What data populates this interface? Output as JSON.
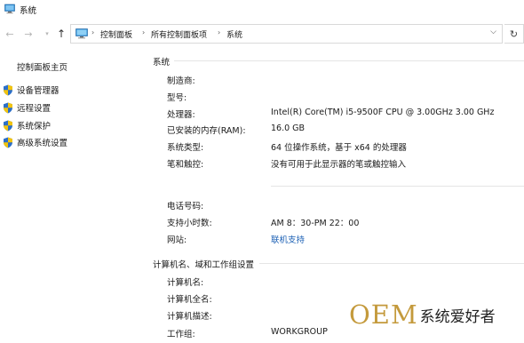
{
  "window": {
    "title": "系统"
  },
  "address": {
    "breadcrumbs": [
      "控制面板",
      "所有控制面板项",
      "系统"
    ]
  },
  "sidebar": {
    "home": "控制面板主页",
    "items": [
      {
        "label": "设备管理器",
        "icon": "shield-icon"
      },
      {
        "label": "远程设置",
        "icon": "shield-icon"
      },
      {
        "label": "系统保护",
        "icon": "shield-icon"
      },
      {
        "label": "高级系统设置",
        "icon": "shield-icon"
      }
    ]
  },
  "system": {
    "heading": "系统",
    "manufacturer_label": "制造商:",
    "model_label": "型号:",
    "processor_label": "处理器:",
    "processor_value": "Intel(R) Core(TM) i5-9500F CPU @ 3.00GHz   3.00 GHz",
    "ram_label": "已安装的内存(RAM):",
    "ram_value": "16.0 GB",
    "type_label": "系统类型:",
    "type_value": "64 位操作系统，基于 x64 的处理器",
    "pen_label": "笔和触控:",
    "pen_value": "没有可用于此显示器的笔或触控输入"
  },
  "support": {
    "phone_label": "电话号码:",
    "hours_label": "支持小时数:",
    "hours_value": "AM 8：30-PM 22：00",
    "website_label": "网站:",
    "website_value": "联机支持"
  },
  "computer": {
    "heading": "计算机名、域和工作组设置",
    "name_label": "计算机名:",
    "fullname_label": "计算机全名:",
    "description_label": "计算机描述:",
    "workgroup_label": "工作组:",
    "workgroup_value": "WORKGROUP"
  },
  "watermark": {
    "text_latin": "OEM",
    "text_cn": "系统爱好者"
  },
  "colors": {
    "link": "#1a5fb4",
    "watermark_gold": "#c49a3c"
  }
}
